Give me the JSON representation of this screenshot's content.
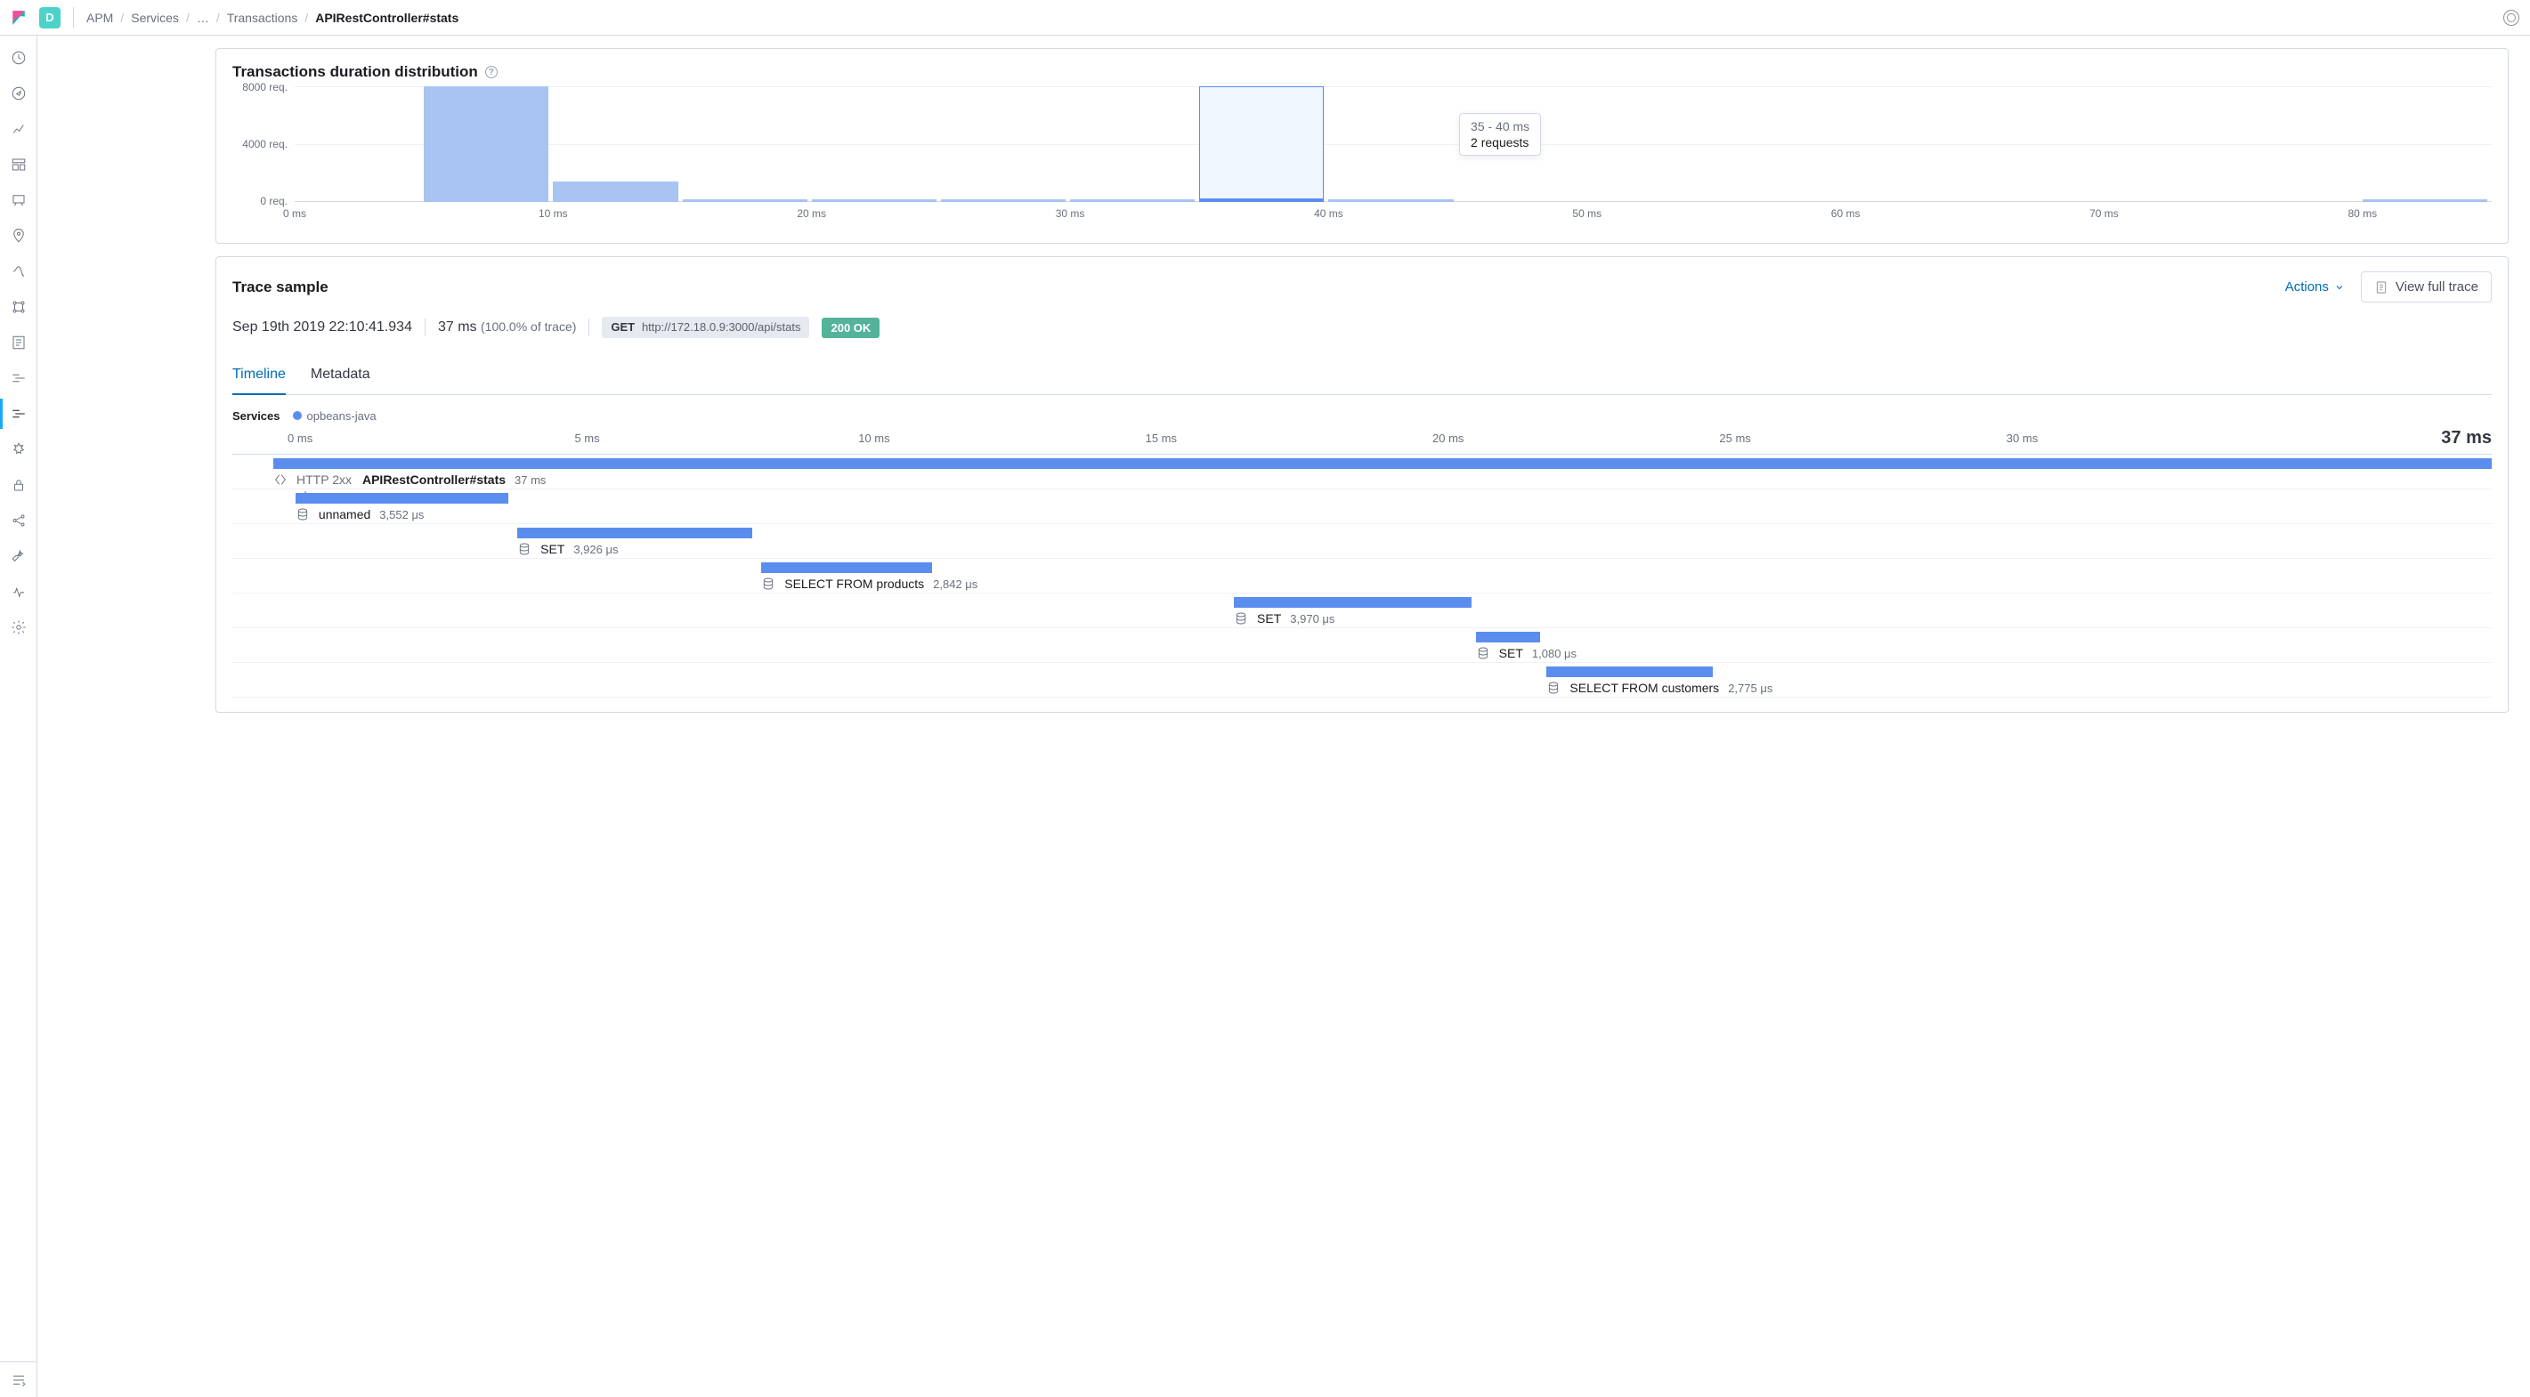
{
  "header": {
    "space_letter": "D",
    "breadcrumb": [
      "APM",
      "Services",
      "…",
      "Transactions",
      "APIRestController#stats"
    ]
  },
  "distribution": {
    "title": "Transactions duration distribution",
    "ylabels": [
      "8000 req.",
      "4000 req.",
      "0 req."
    ],
    "xlabels": [
      "0 ms",
      "10 ms",
      "20 ms",
      "30 ms",
      "40 ms",
      "50 ms",
      "60 ms",
      "70 ms",
      "80 ms"
    ],
    "tooltip": {
      "range": "35 - 40 ms",
      "count": "2 requests"
    }
  },
  "trace": {
    "title": "Trace sample",
    "actions_label": "Actions",
    "view_full_trace": "View full trace",
    "timestamp": "Sep 19th 2019 22:10:41.934",
    "duration": "37 ms",
    "duration_pct": "(100.0% of trace)",
    "request": {
      "method": "GET",
      "url": "http://172.18.0.9:3000/api/stats"
    },
    "status": "200 OK",
    "tabs": [
      "Timeline",
      "Metadata"
    ],
    "services_label": "Services",
    "service_name": "opbeans-java",
    "timeline_ticks": [
      "0 ms",
      "5 ms",
      "10 ms",
      "15 ms",
      "20 ms",
      "25 ms",
      "30 ms"
    ],
    "total": "37 ms",
    "spans": [
      {
        "kind": "root",
        "http": "HTTP 2xx",
        "name": "APIRestController#stats",
        "dur": "37 ms",
        "left": 0,
        "width": 100
      },
      {
        "kind": "db",
        "name": "unnamed",
        "dur": "3,552 μs",
        "left": 1,
        "width": 9.6
      },
      {
        "kind": "db",
        "name": "SET",
        "dur": "3,926 μs",
        "left": 11,
        "width": 10.6
      },
      {
        "kind": "db",
        "name": "SELECT FROM products",
        "dur": "2,842 μs",
        "left": 22,
        "width": 7.7
      },
      {
        "kind": "db",
        "name": "SET",
        "dur": "3,970 μs",
        "left": 43.3,
        "width": 10.7
      },
      {
        "kind": "db",
        "name": "SET",
        "dur": "1,080 μs",
        "left": 54.2,
        "width": 2.9
      },
      {
        "kind": "db",
        "name": "SELECT FROM customers",
        "dur": "2,775 μs",
        "left": 57.4,
        "width": 7.5
      }
    ]
  },
  "chart_data": {
    "type": "bar",
    "title": "Transactions duration distribution",
    "xlabel": "ms",
    "ylabel": "req.",
    "ylim": [
      0,
      8000
    ],
    "bins_ms": [
      [
        5,
        10
      ],
      [
        10,
        15
      ],
      [
        15,
        20
      ],
      [
        20,
        25
      ],
      [
        25,
        30
      ],
      [
        30,
        35
      ],
      [
        35,
        40
      ],
      [
        40,
        45
      ],
      [
        80,
        85
      ]
    ],
    "values": [
      8000,
      1400,
      140,
      140,
      140,
      140,
      2,
      140,
      140
    ],
    "selected_bin": [
      35,
      40
    ],
    "selected_count": 2
  }
}
